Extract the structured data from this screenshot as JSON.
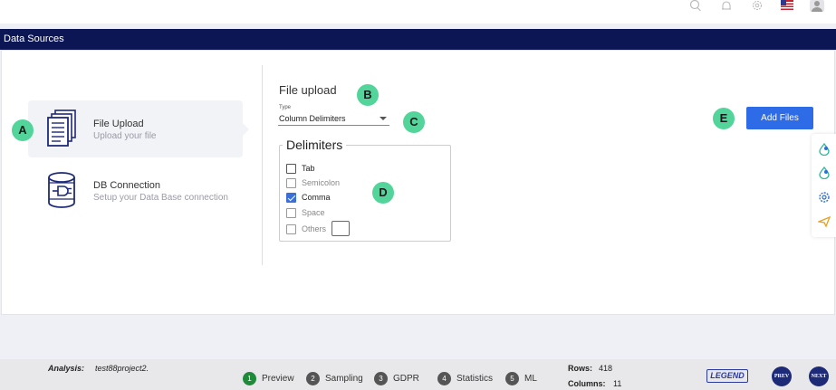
{
  "window": {
    "title": "Data Sources"
  },
  "header_icons": [
    "search-icon",
    "bell-icon",
    "gear-icon",
    "us-flag-icon",
    "user-avatar-icon"
  ],
  "sources": [
    {
      "title": "File Upload",
      "subtitle": "Upload your file",
      "icon": "document-stack-icon",
      "active": true
    },
    {
      "title": "DB Connection",
      "subtitle": "Setup your Data Base connection",
      "icon": "database-connection-icon",
      "active": false
    }
  ],
  "upload": {
    "title": "File upload",
    "type_label": "Type",
    "type_value": "Column Delimiters",
    "delimiters_title": "Delimiters",
    "options": [
      {
        "label": "Tab",
        "checked": false,
        "enabled": true
      },
      {
        "label": "Semicolon",
        "checked": false,
        "enabled": false
      },
      {
        "label": "Comma",
        "checked": true,
        "enabled": true
      },
      {
        "label": "Space",
        "checked": false,
        "enabled": false
      },
      {
        "label": "Others",
        "checked": false,
        "enabled": false
      }
    ],
    "add_files_label": "Add Files"
  },
  "annotations": [
    "A",
    "B",
    "C",
    "D",
    "E"
  ],
  "side_tools": [
    "paint-drop-icon",
    "paint-drop-icon",
    "gear-icon",
    "send-icon"
  ],
  "footer": {
    "analysis_label": "Analysis:",
    "analysis_value": "test88project2.",
    "steps": [
      {
        "num": "1",
        "label": "Preview",
        "active": true
      },
      {
        "num": "2",
        "label": "Sampling",
        "active": false
      },
      {
        "num": "3",
        "label": "GDPR",
        "active": false
      },
      {
        "num": "4",
        "label": "Statistics",
        "active": false
      },
      {
        "num": "5",
        "label": "ML",
        "active": false
      }
    ],
    "rows_label": "Rows:",
    "rows_value": "418",
    "columns_label": "Columns:",
    "columns_value": "11",
    "legend_label": "LEGEND",
    "prev_label": "PREV",
    "next_label": "NEXT"
  },
  "colors": {
    "titlebar": "#0d1655",
    "accent": "#2e6be6",
    "annotation": "#52d49a",
    "active_step": "#1e8a3a"
  }
}
